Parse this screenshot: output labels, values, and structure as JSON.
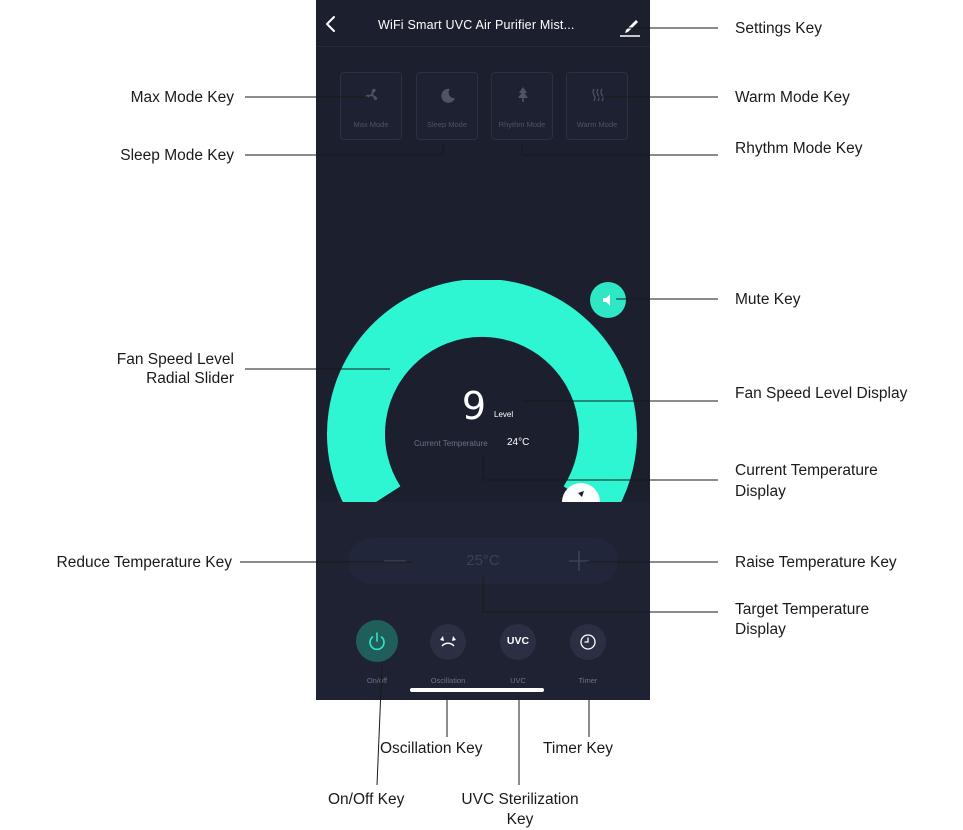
{
  "app": {
    "title": "WiFi Smart UVC Air Purifier Mist..."
  },
  "modes": [
    {
      "label": "Max Mode",
      "icon": "fan-icon"
    },
    {
      "label": "Sleep Mode",
      "icon": "moon-icon"
    },
    {
      "label": "Rhythm Mode",
      "icon": "tree-icon"
    },
    {
      "label": "Warm Mode",
      "icon": "heat-waves-icon"
    }
  ],
  "fan": {
    "level": "9",
    "level_unit": "Level"
  },
  "current_temp": {
    "label": "Current Temperature",
    "value": "24°C"
  },
  "target_temp": {
    "value": "25°C"
  },
  "bottom": {
    "power_label": "On/off",
    "oscillation_label": "Oscillation",
    "uvc_label": "UVC",
    "uvc_text": "UVC",
    "timer_label": "Timer"
  },
  "callouts": {
    "settings": "Settings Key",
    "max_mode": "Max Mode Key",
    "warm_mode": "Warm Mode Key",
    "sleep_mode": "Sleep Mode Key",
    "rhythm_mode": "Rhythm Mode Key",
    "mute": "Mute Key",
    "fan_slider_line1": "Fan Speed Level",
    "fan_slider_line2": "Radial Slider",
    "fan_display": "Fan Speed Level Display",
    "cur_temp_line1": "Current Temperature",
    "cur_temp_line2": "Display",
    "reduce_temp": "Reduce Temperature Key",
    "raise_temp": "Raise Temperature Key",
    "target_temp_line1": "Target Temperature",
    "target_temp_line2": "Display",
    "oscillation": "Oscillation Key",
    "timer": "Timer Key",
    "onoff": "On/Off Key",
    "uvc_line1": "UVC Sterilization",
    "uvc_line2": "Key"
  },
  "colors": {
    "accent": "#2ee8c5",
    "background": "#1b1f2e",
    "power_button": "#1f5e5b"
  }
}
